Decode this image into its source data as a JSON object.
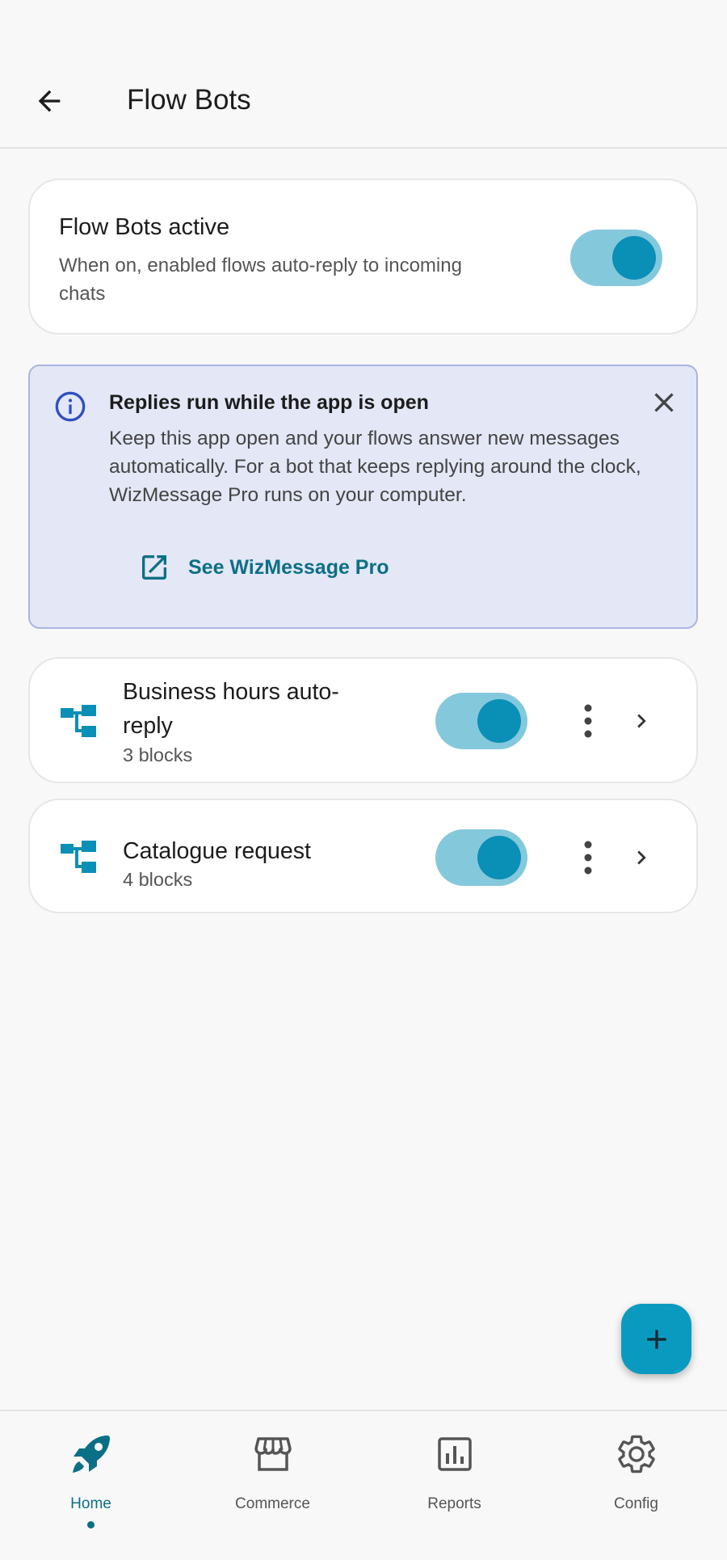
{
  "appbar": {
    "title": "Flow Bots",
    "back_icon": "arrow-back-icon"
  },
  "master": {
    "title": "Flow Bots active",
    "description": "When on, enabled flows auto-reply to incoming chats",
    "enabled": true
  },
  "banner": {
    "title": "Replies run while the app is open",
    "body": "Keep this app open and your flows answer new messages automatically. For a bot that keeps replying around the clock, WizMessage Pro runs on your computer.",
    "link_label": "See WizMessage Pro",
    "icons": [
      "info-icon",
      "close-icon",
      "open-external-icon"
    ]
  },
  "flows": [
    {
      "name": "Business hours auto-reply",
      "blocks": "3 blocks",
      "enabled": true
    },
    {
      "name": "Catalogue request",
      "blocks": "4 blocks",
      "enabled": true
    }
  ],
  "fab": {
    "icon": "plus-icon"
  },
  "nav": {
    "active": "Home",
    "items": [
      {
        "label": "Home",
        "icon": "rocket-icon"
      },
      {
        "label": "Commerce",
        "icon": "storefront-icon"
      },
      {
        "label": "Reports",
        "icon": "bar-chart-icon"
      },
      {
        "label": "Config",
        "icon": "gear-icon"
      }
    ]
  },
  "colors": {
    "accent": "#0a8fb6",
    "toggle_track": "#84c8dc",
    "banner_bg": "#e3e7f6",
    "link": "#0d6f85"
  }
}
